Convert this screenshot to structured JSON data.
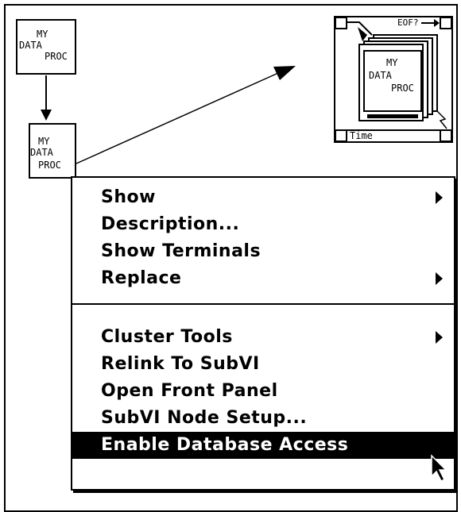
{
  "icon_top": {
    "line1": "MY",
    "line2": "DATA",
    "line3": "PROC"
  },
  "icon_mid": {
    "line1": "MY",
    "line2": "DATA",
    "line3": "PROC"
  },
  "config_icon": {
    "eof_label": "EOF?",
    "time_label": "Time",
    "inner": {
      "line1": "MY",
      "line2": "DATA",
      "line3": "PROC"
    }
  },
  "menu": {
    "group1": [
      {
        "label": "Show",
        "submenu": true
      },
      {
        "label": "Description...",
        "submenu": false
      },
      {
        "label": "Show Terminals",
        "submenu": false
      },
      {
        "label": "Replace",
        "submenu": true
      }
    ],
    "group2": [
      {
        "label": "Cluster Tools",
        "submenu": true
      },
      {
        "label": "Relink To SubVI",
        "submenu": false
      },
      {
        "label": "Open Front Panel",
        "submenu": false
      },
      {
        "label": "SubVI Node Setup...",
        "submenu": false
      },
      {
        "label": "Enable Database Access",
        "submenu": false,
        "highlighted": true
      }
    ]
  }
}
